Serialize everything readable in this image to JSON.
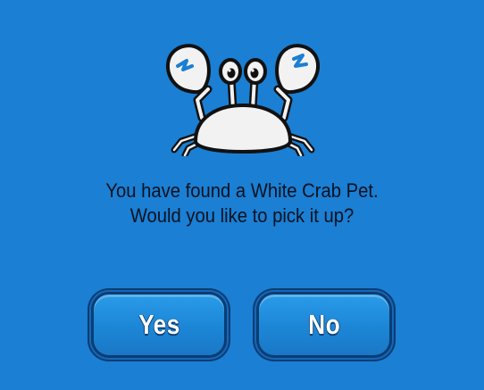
{
  "dialog": {
    "icon": "white-crab-icon",
    "message_line1": "You have found a White Crab Pet.",
    "message_line2": "Would you like to pick it up?",
    "yes_label": "Yes",
    "no_label": "No"
  },
  "colors": {
    "background": "#1b7fd3",
    "button_fill": "#1c86d6",
    "button_border": "#0b3d74",
    "text_dark": "#0a1220",
    "crab_body": "#f2f2f2"
  }
}
